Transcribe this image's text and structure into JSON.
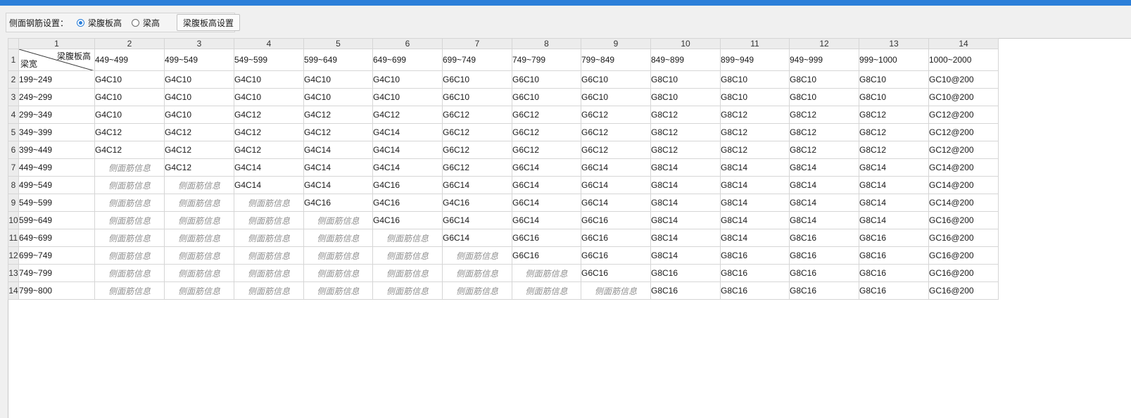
{
  "toolbar": {
    "label": "侧面钢筋设置：",
    "radio_options": [
      {
        "label": "梁腹板高",
        "checked": true
      },
      {
        "label": "梁高",
        "checked": false
      }
    ],
    "button_label": "梁腹板高设置"
  },
  "colors": {
    "accent": "#2b7fd9",
    "placeholder_text": "#8f8f8f"
  },
  "table": {
    "column_headers": [
      "1",
      "2",
      "3",
      "4",
      "5",
      "6",
      "7",
      "8",
      "9",
      "10",
      "11",
      "12",
      "13",
      "14"
    ],
    "row_headers": [
      "1",
      "2",
      "3",
      "4",
      "5",
      "6",
      "7",
      "8",
      "9",
      "10",
      "11",
      "12",
      "13",
      "14"
    ],
    "corner_top_label": "梁腹板高",
    "corner_bottom_label": "梁宽",
    "placeholder_text": "侧面筋信息",
    "height_ranges": [
      "449~499",
      "499~549",
      "549~599",
      "599~649",
      "649~699",
      "699~749",
      "749~799",
      "799~849",
      "849~899",
      "899~949",
      "949~999",
      "999~1000",
      "1000~2000"
    ],
    "rows": [
      {
        "width_range": "199~249",
        "values": [
          "G4C10",
          "G4C10",
          "G4C10",
          "G4C10",
          "G4C10",
          "G6C10",
          "G6C10",
          "G6C10",
          "G8C10",
          "G8C10",
          "G8C10",
          "G8C10",
          "GC10@200"
        ]
      },
      {
        "width_range": "249~299",
        "values": [
          "G4C10",
          "G4C10",
          "G4C10",
          "G4C10",
          "G4C10",
          "G6C10",
          "G6C10",
          "G6C10",
          "G8C10",
          "G8C10",
          "G8C10",
          "G8C10",
          "GC10@200"
        ]
      },
      {
        "width_range": "299~349",
        "values": [
          "G4C10",
          "G4C10",
          "G4C12",
          "G4C12",
          "G4C12",
          "G6C12",
          "G6C12",
          "G6C12",
          "G8C12",
          "G8C12",
          "G8C12",
          "G8C12",
          "GC12@200"
        ]
      },
      {
        "width_range": "349~399",
        "values": [
          "G4C12",
          "G4C12",
          "G4C12",
          "G4C12",
          "G4C14",
          "G6C12",
          "G6C12",
          "G6C12",
          "G8C12",
          "G8C12",
          "G8C12",
          "G8C12",
          "GC12@200"
        ]
      },
      {
        "width_range": "399~449",
        "values": [
          "G4C12",
          "G4C12",
          "G4C12",
          "G4C14",
          "G4C14",
          "G6C12",
          "G6C12",
          "G6C12",
          "G8C12",
          "G8C12",
          "G8C12",
          "G8C12",
          "GC12@200"
        ]
      },
      {
        "width_range": "449~499",
        "values": [
          "侧面筋信息",
          "G4C12",
          "G4C14",
          "G4C14",
          "G4C14",
          "G6C12",
          "G6C14",
          "G6C14",
          "G8C14",
          "G8C14",
          "G8C14",
          "G8C14",
          "GC14@200"
        ]
      },
      {
        "width_range": "499~549",
        "values": [
          "侧面筋信息",
          "侧面筋信息",
          "G4C14",
          "G4C14",
          "G4C16",
          "G6C14",
          "G6C14",
          "G6C14",
          "G8C14",
          "G8C14",
          "G8C14",
          "G8C14",
          "GC14@200"
        ]
      },
      {
        "width_range": "549~599",
        "values": [
          "侧面筋信息",
          "侧面筋信息",
          "侧面筋信息",
          "G4C16",
          "G4C16",
          "G4C16",
          "G6C14",
          "G6C14",
          "G8C14",
          "G8C14",
          "G8C14",
          "G8C14",
          "GC14@200"
        ]
      },
      {
        "width_range": "599~649",
        "values": [
          "侧面筋信息",
          "侧面筋信息",
          "侧面筋信息",
          "侧面筋信息",
          "G4C16",
          "G6C14",
          "G6C14",
          "G6C16",
          "G8C14",
          "G8C14",
          "G8C14",
          "G8C14",
          "GC16@200"
        ]
      },
      {
        "width_range": "649~699",
        "values": [
          "侧面筋信息",
          "侧面筋信息",
          "侧面筋信息",
          "侧面筋信息",
          "侧面筋信息",
          "G6C14",
          "G6C16",
          "G6C16",
          "G8C14",
          "G8C14",
          "G8C16",
          "G8C16",
          "GC16@200"
        ]
      },
      {
        "width_range": "699~749",
        "values": [
          "侧面筋信息",
          "侧面筋信息",
          "侧面筋信息",
          "侧面筋信息",
          "侧面筋信息",
          "侧面筋信息",
          "G6C16",
          "G6C16",
          "G8C14",
          "G8C16",
          "G8C16",
          "G8C16",
          "GC16@200"
        ]
      },
      {
        "width_range": "749~799",
        "values": [
          "侧面筋信息",
          "侧面筋信息",
          "侧面筋信息",
          "侧面筋信息",
          "侧面筋信息",
          "侧面筋信息",
          "侧面筋信息",
          "G6C16",
          "G8C16",
          "G8C16",
          "G8C16",
          "G8C16",
          "GC16@200"
        ]
      },
      {
        "width_range": "799~800",
        "values": [
          "侧面筋信息",
          "侧面筋信息",
          "侧面筋信息",
          "侧面筋信息",
          "侧面筋信息",
          "侧面筋信息",
          "侧面筋信息",
          "侧面筋信息",
          "G8C16",
          "G8C16",
          "G8C16",
          "G8C16",
          "GC16@200"
        ]
      }
    ]
  }
}
